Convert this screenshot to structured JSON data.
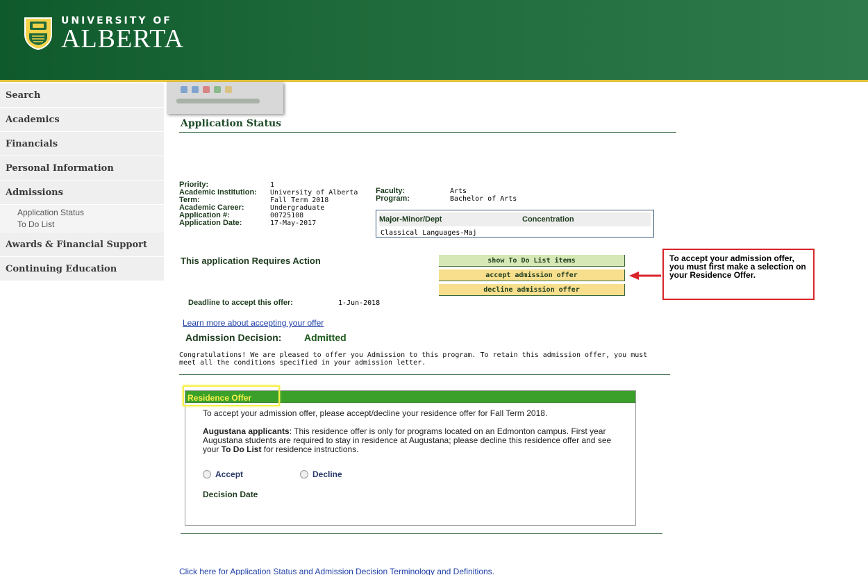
{
  "header": {
    "logo_top": "UNIVERSITY OF",
    "logo_main": "ALBERTA",
    "brand_green": "#1f6a3a",
    "brand_gold": "#e3c13b"
  },
  "sidebar": {
    "items": [
      {
        "label": "Search"
      },
      {
        "label": "Academics"
      },
      {
        "label": "Financials"
      },
      {
        "label": "Personal Information"
      },
      {
        "label": "Admissions"
      },
      {
        "label": "Awards & Financial Support"
      },
      {
        "label": "Continuing Education"
      }
    ],
    "admissions_sub": [
      {
        "label": "Application Status"
      },
      {
        "label": "To Do List"
      }
    ]
  },
  "page": {
    "title": "Application Status",
    "info": [
      {
        "label": "Priority:",
        "value": "1"
      },
      {
        "label": "Academic Institution:",
        "value": "University of Alberta"
      },
      {
        "label": "Term:",
        "value": "Fall Term 2018"
      },
      {
        "label": "Academic Career:",
        "value": "Undergraduate"
      },
      {
        "label": "Application #:",
        "value": "00725108"
      },
      {
        "label": "Application Date:",
        "value": "17-May-2017"
      }
    ],
    "faculty": [
      {
        "label": "Faculty:",
        "value": "Arts"
      },
      {
        "label": "Program:",
        "value": "Bachelor of Arts"
      }
    ],
    "major_header": "Major-Minor/Dept",
    "concentration_header": "Concentration",
    "major_value": "Classical Languages-Maj",
    "requires_action": "This application Requires Action",
    "buttons": {
      "todo": "show To Do List items",
      "accept": "accept admission offer",
      "decline": "decline admission offer"
    },
    "callout": "To accept your admission offer, you must first make a selection on your Residence Offer.",
    "deadline_label": "Deadline to accept this offer:",
    "deadline_value": "1-Jun-2018",
    "learn_more": "Learn more about accepting your offer",
    "decision_label": "Admission Decision:",
    "decision_value": "Admitted",
    "congrats": "Congratulations!  We are pleased to offer you Admission to this program. To retain this admission offer, you must meet all the conditions specified in your admission letter.",
    "residence": {
      "title": "Residence Offer",
      "intro": "To accept your admission offer, please accept/decline your residence offer for Fall Term 2018.",
      "augustana_bold": "Augustana applicants",
      "augustana_text1": ": This residence offer is only for programs located on an Edmonton campus. First year Augustana students are required to stay in residence at Augustana; please decline this residence offer and see your ",
      "todo_bold": "To Do List",
      "augustana_text2": " for residence instructions.",
      "accept_label": "Accept",
      "decline_label": "Decline",
      "decision_date_label": "Decision Date"
    },
    "bottom_link": "Click here for Application Status and Admission Decision Terminology and Definitions."
  }
}
